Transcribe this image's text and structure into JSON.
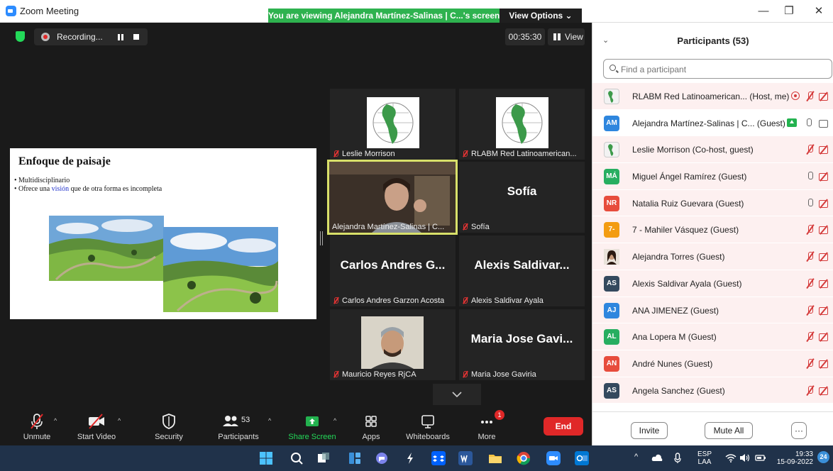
{
  "window": {
    "title": "Zoom Meeting",
    "share_banner": "You are viewing Alejandra Martínez-Salinas | C...'s screen",
    "view_options": "View Options ⌄",
    "minimize": "—",
    "restore": "❐",
    "close": "✕"
  },
  "meeting": {
    "recording_label": "Recording...",
    "timer": "00:35:30",
    "view_label": "View"
  },
  "slide": {
    "title": "Enfoque de paisaje",
    "bullet1": "Multidisciplinario",
    "bullet2_pre": "Ofrece una ",
    "bullet2_hl": "visión",
    "bullet2_post": " que de otra forma es incompleta"
  },
  "tiles": {
    "t1": "Leslie Morrison",
    "t2": "RLABM Red Latinoamerican...",
    "t3": "Alejandra Martínez-Salinas | C...",
    "t4": "Sofía",
    "t4_big": "Sofía",
    "t5": "Carlos Andres Garzon Acosta",
    "t5_big": "Carlos Andres G...",
    "t6": "Alexis Saldivar Ayala",
    "t6_big": "Alexis Saldivar...",
    "t7": "Mauricio Reyes RjCA",
    "t8": "Maria Jose Gaviria",
    "t8_big": "Maria Jose Gavi..."
  },
  "toolbar": {
    "unmute": "Unmute",
    "start_video": "Start Video",
    "security": "Security",
    "participants": "Participants",
    "participants_count": "53",
    "share_screen": "Share Screen",
    "apps": "Apps",
    "whiteboards": "Whiteboards",
    "more": "More",
    "more_badge": "1",
    "end": "End"
  },
  "panel": {
    "title": "Participants (53)",
    "search_placeholder": "Find a participant",
    "invite": "Invite",
    "mute_all": "Mute All",
    "more": "···",
    "participants": [
      {
        "name": "RLABM Red Latinoamerican... (Host, me)",
        "avatar": "",
        "color": "#f2f2f2"
      },
      {
        "name": "Alejandra Martínez-Salinas | C... (Guest)",
        "avatar": "AM",
        "color": "#2e86de"
      },
      {
        "name": "Leslie Morrison (Co-host, guest)",
        "avatar": "",
        "color": "#f2f2f2"
      },
      {
        "name": "Miguel Ángel Ramírez (Guest)",
        "avatar": "MÁ",
        "color": "#27ae60"
      },
      {
        "name": "Natalia Ruiz Guevara (Guest)",
        "avatar": "NR",
        "color": "#e74c3c"
      },
      {
        "name": "7 - Mahiler Vásquez (Guest)",
        "avatar": "7-",
        "color": "#f39c12"
      },
      {
        "name": "Alejandra Torres (Guest)",
        "avatar": "",
        "color": "#6b4a3a"
      },
      {
        "name": "Alexis Saldivar Ayala (Guest)",
        "avatar": "AS",
        "color": "#34495e"
      },
      {
        "name": "ANA JIMENEZ (Guest)",
        "avatar": "AJ",
        "color": "#2e86de"
      },
      {
        "name": "Ana Lopera M (Guest)",
        "avatar": "AL",
        "color": "#27ae60"
      },
      {
        "name": "André Nunes (Guest)",
        "avatar": "AN",
        "color": "#e74c3c"
      },
      {
        "name": "Angela Sanchez (Guest)",
        "avatar": "AS",
        "color": "#34495e"
      }
    ]
  },
  "taskbar": {
    "lang_top": "ESP",
    "lang_bottom": "LAA",
    "time": "19:33",
    "date": "15-09-2022",
    "notif_count": "24"
  }
}
